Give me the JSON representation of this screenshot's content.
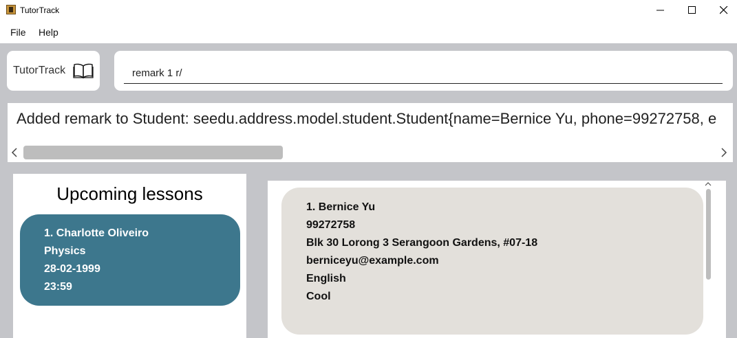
{
  "window": {
    "title": "TutorTrack"
  },
  "menu": {
    "file": "File",
    "help": "Help"
  },
  "brand": {
    "label": "TutorTrack",
    "icon": "book-icon"
  },
  "command": {
    "value": "remark 1 r/"
  },
  "result": {
    "text": "Added remark to Student: seedu.address.model.student.Student{name=Bernice Yu, phone=99272758, e"
  },
  "lessons": {
    "title": "Upcoming lessons",
    "items": [
      {
        "heading": "1.  Charlotte Oliveiro",
        "subject": "Physics",
        "date": "28-02-1999",
        "time": "23:59"
      }
    ]
  },
  "students": [
    {
      "heading": "1.  Bernice Yu",
      "phone": "99272758",
      "address": "Blk 30 Lorong 3 Serangoon Gardens, #07-18",
      "email": "berniceyu@example.com",
      "subject": "English",
      "remark": "Cool"
    }
  ],
  "colors": {
    "lesson_card": "#3d778d",
    "student_card": "#e3e0db",
    "background": "#c4c5c9"
  }
}
